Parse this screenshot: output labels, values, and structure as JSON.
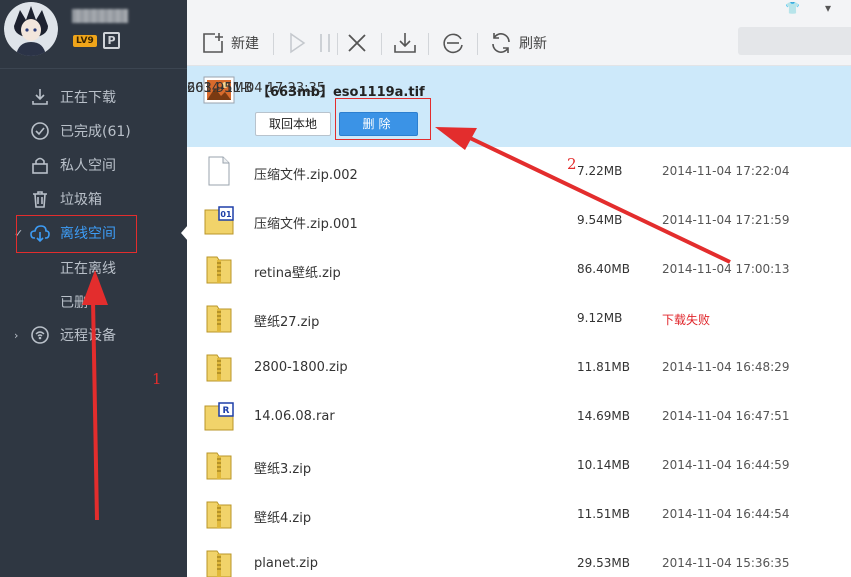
{
  "user": {
    "level": "LV9",
    "vip_badge": "P"
  },
  "sidebar": {
    "items": [
      {
        "label": "正在下载",
        "icon": "download-icon"
      },
      {
        "label": "已完成(61)",
        "icon": "check-circle-icon"
      },
      {
        "label": "私人空间",
        "icon": "lock-icon"
      },
      {
        "label": "垃圾箱",
        "icon": "trash-icon"
      },
      {
        "label": "离线空间",
        "icon": "cloud-download-icon"
      },
      {
        "label": "远程设备",
        "icon": "remote-device-icon"
      }
    ],
    "sub_items": [
      "正在离线",
      "已删"
    ]
  },
  "toolbar": {
    "new_label": "新建",
    "refresh_label": "刷新"
  },
  "files": [
    {
      "name": "【663mb】eso1119a.tif",
      "size": "663.95MB",
      "date": "2014-11-04  17:23:35",
      "type": "image",
      "selected": true
    },
    {
      "name": "压缩文件.zip.002",
      "size": "7.22MB",
      "date": "2014-11-04  17:22:04",
      "type": "blank"
    },
    {
      "name": "压缩文件.zip.001",
      "size": "9.54MB",
      "date": "2014-11-04  17:21:59",
      "type": "archive-01"
    },
    {
      "name": "retina壁纸.zip",
      "size": "86.40MB",
      "date": "2014-11-04  17:00:13",
      "type": "zip"
    },
    {
      "name": "壁纸27.zip",
      "size": "9.12MB",
      "status": "下载失败",
      "type": "zip"
    },
    {
      "name": "2800-1800.zip",
      "size": "11.81MB",
      "date": "2014-11-04  16:48:29",
      "type": "zip"
    },
    {
      "name": "14.06.08.rar",
      "size": "14.69MB",
      "date": "2014-11-04  16:47:51",
      "type": "rar"
    },
    {
      "name": "壁纸3.zip",
      "size": "10.14MB",
      "date": "2014-11-04  16:44:59",
      "type": "zip"
    },
    {
      "name": "壁纸4.zip",
      "size": "11.51MB",
      "date": "2014-11-04  16:44:54",
      "type": "zip"
    },
    {
      "name": "planet.zip",
      "size": "29.53MB",
      "date": "2014-11-04  15:36:35",
      "type": "zip"
    }
  ],
  "selected_actions": {
    "retrieve_label": "取回本地",
    "delete_label": "删除"
  },
  "annotations": {
    "label_1": "1",
    "label_2": "2"
  },
  "colors": {
    "sidebar_bg": "#2f3742",
    "accent": "#3d9cf5",
    "selected_row": "#cde9fa",
    "annotation": "#e32d2d",
    "error": "#e0262b"
  }
}
